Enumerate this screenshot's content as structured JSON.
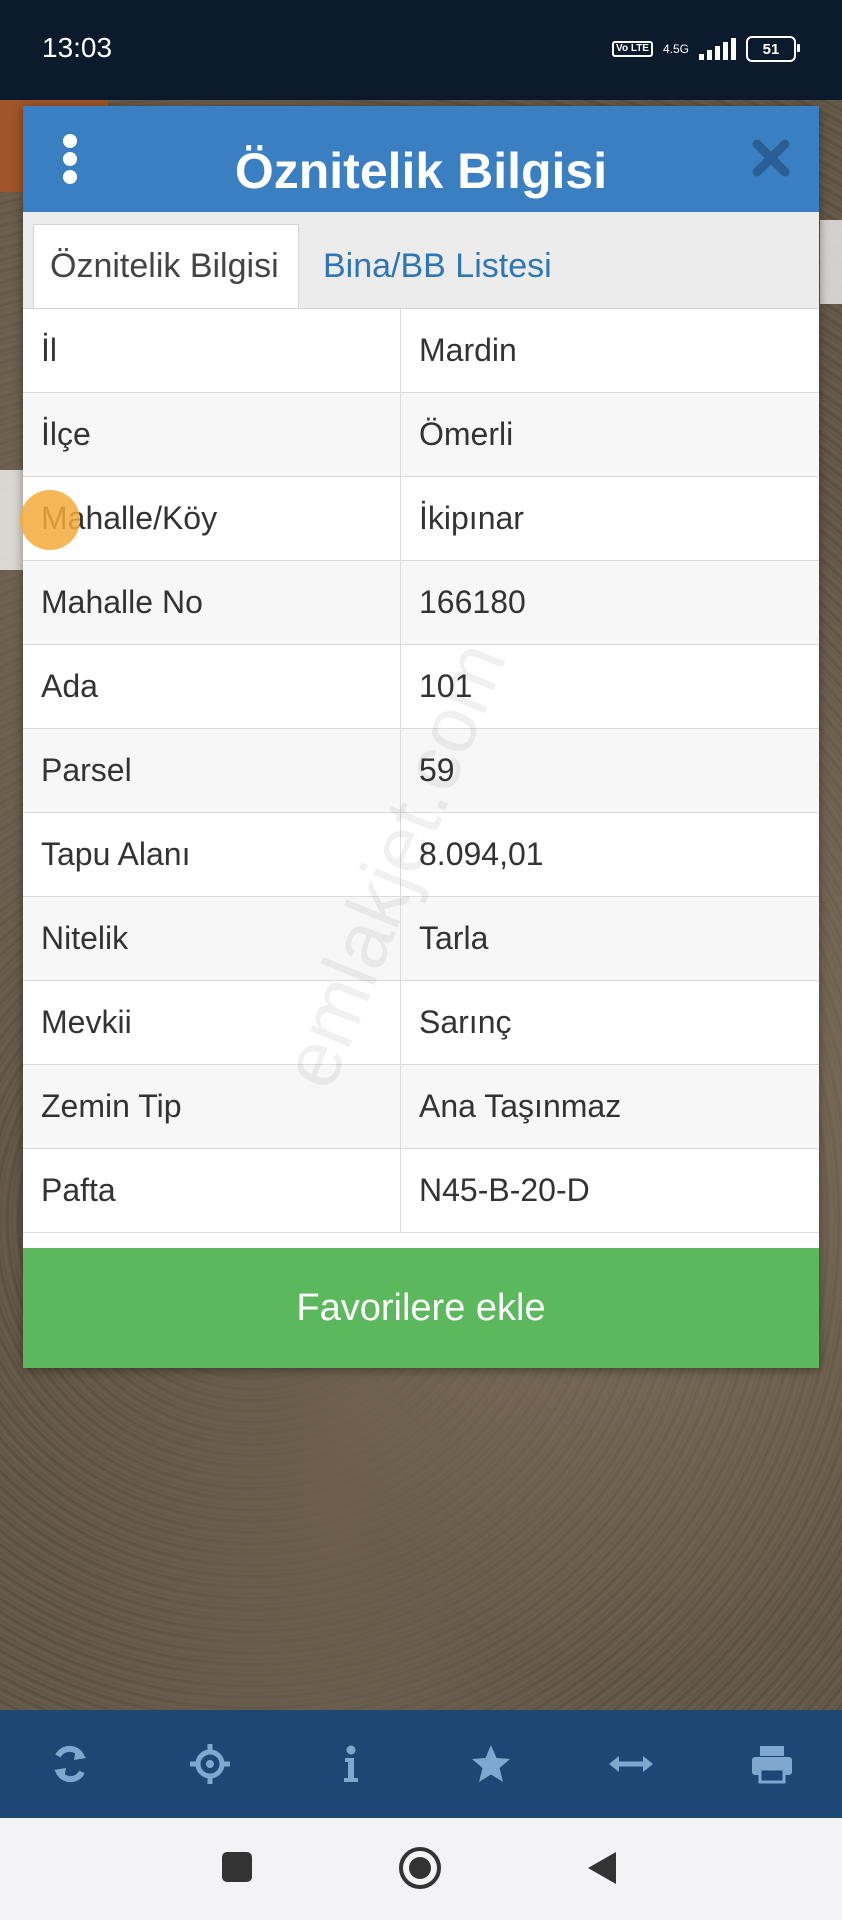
{
  "status_bar": {
    "time": "13:03",
    "volte": "Vo LTE",
    "network": "4.5G",
    "battery": "51"
  },
  "dialog": {
    "title": "Öznitelik Bilgisi",
    "tabs": [
      {
        "label": "Öznitelik Bilgisi",
        "active": true
      },
      {
        "label": "Bina/BB Listesi",
        "active": false
      }
    ],
    "rows": [
      {
        "key": "İl",
        "value": "Mardin"
      },
      {
        "key": "İlçe",
        "value": "Ömerli"
      },
      {
        "key": "Mahalle/Köy",
        "value": "İkipınar"
      },
      {
        "key": "Mahalle No",
        "value": "166180"
      },
      {
        "key": "Ada",
        "value": "101"
      },
      {
        "key": "Parsel",
        "value": "59"
      },
      {
        "key": "Tapu Alanı",
        "value": "8.094,01"
      },
      {
        "key": "Nitelik",
        "value": "Tarla"
      },
      {
        "key": "Mevkii",
        "value": "Sarınç"
      },
      {
        "key": "Zemin Tip",
        "value": "Ana Taşınmaz"
      },
      {
        "key": "Pafta",
        "value": "N45-B-20-D"
      }
    ],
    "favorite_button": "Favorilere ekle"
  },
  "watermark": "emlakjet.com",
  "toolbar": [
    "refresh-icon",
    "locate-icon",
    "info-icon",
    "star-icon",
    "measure-icon",
    "print-icon"
  ],
  "colors": {
    "header": "#3a7fc1",
    "button": "#5cb85c",
    "toolbar": "#1d4876"
  }
}
